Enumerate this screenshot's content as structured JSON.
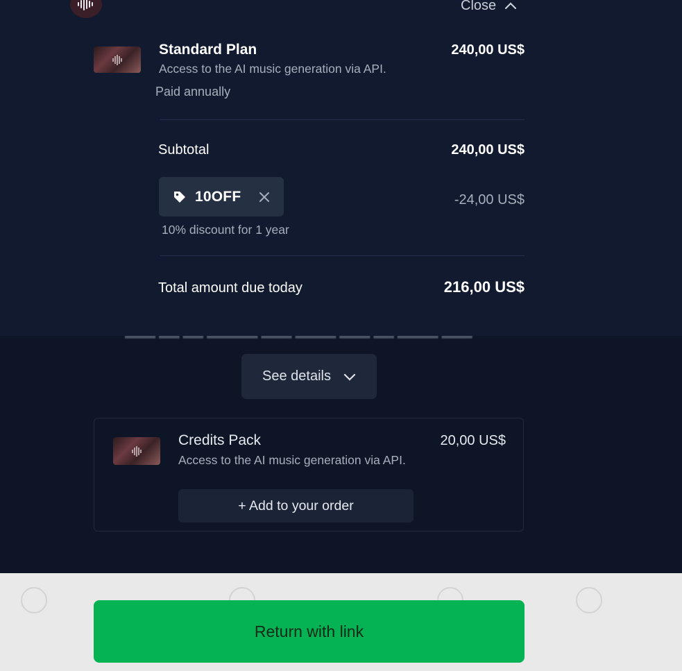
{
  "header": {
    "close_label": "Close"
  },
  "plan": {
    "title": "Standard Plan",
    "description": "Access to the AI music generation via API.",
    "billing": "Paid annually",
    "price": "240,00 US$"
  },
  "summary": {
    "subtotal_label": "Subtotal",
    "subtotal_value": "240,00 US$",
    "promo_code": "10OFF",
    "promo_discount": "-24,00 US$",
    "promo_note": "10% discount for 1 year",
    "total_label": "Total amount due today",
    "total_value": "216,00 US$"
  },
  "see_details_label": "See details",
  "upsell": {
    "title": "Credits Pack",
    "description": "Access to the AI music generation via API.",
    "price": "20,00 US$",
    "add_label": "+ Add to your order"
  },
  "footer": {
    "return_label": "Return with link"
  },
  "icons": {
    "logo": "waveform-icon",
    "close": "chevron-up-icon",
    "promo": "tag-icon",
    "remove": "close-icon",
    "details": "chevron-down-icon"
  },
  "colors": {
    "background": "#0e1527",
    "panel": "#111a2e",
    "accent_green": "#05b354"
  }
}
